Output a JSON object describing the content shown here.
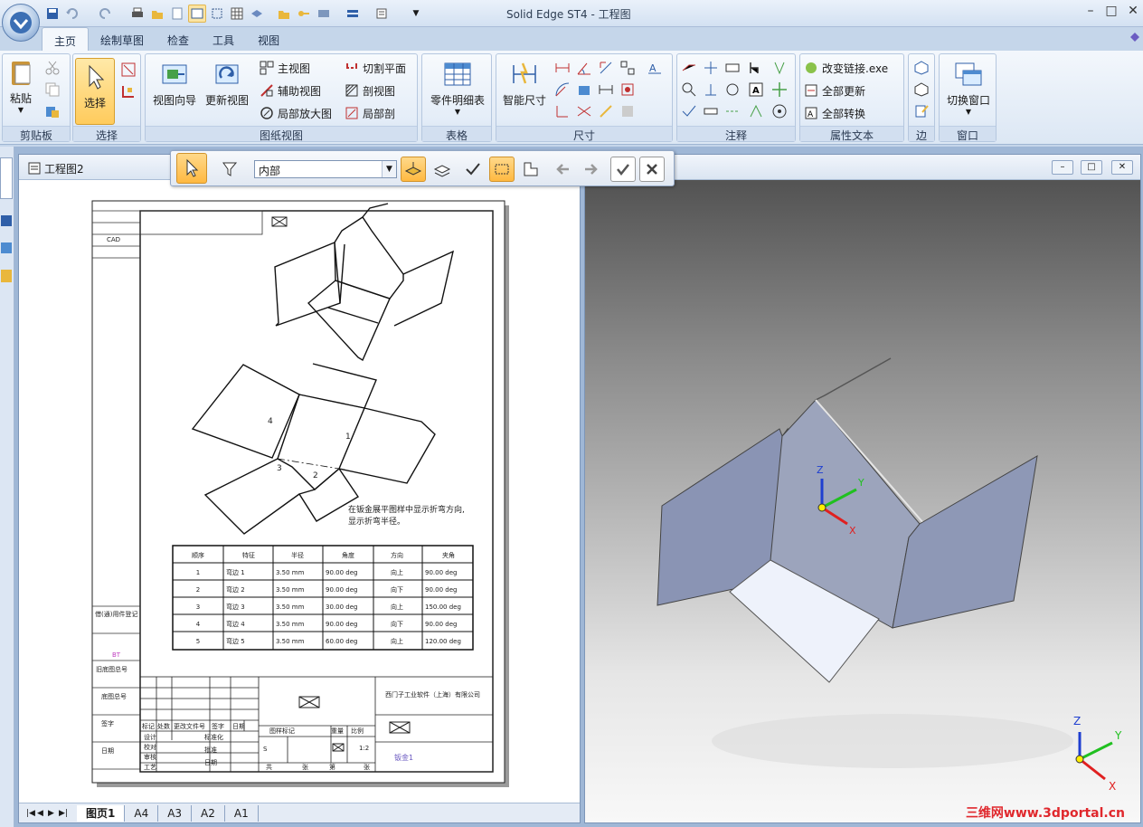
{
  "window": {
    "title": "Solid Edge ST4 - 工程图"
  },
  "title_controls": {
    "minimize": "–",
    "restore": "□",
    "close": "✕"
  },
  "tabs": [
    "主页",
    "绘制草图",
    "检查",
    "工具",
    "视图"
  ],
  "ribbon": {
    "clipboard": {
      "label": "剪贴板",
      "paste": "粘贴"
    },
    "select": {
      "label": "选择",
      "select": "选择"
    },
    "drawing_views": {
      "label": "图纸视图",
      "view_wizard": "视图向导",
      "update_views": "更新视图",
      "principal_view": "主视图",
      "auxiliary_view": "辅助视图",
      "detail_view": "局部放大图",
      "cutting_plane": "切割平面",
      "section_view": "剖视图",
      "broken_out_section": "局部剖"
    },
    "tables": {
      "label": "表格",
      "parts_list": "零件明细表"
    },
    "dimensions": {
      "label": "尺寸",
      "smart_dimension": "智能尺寸"
    },
    "annotation": {
      "label": "注释"
    },
    "property_text": {
      "label": "属性文本",
      "change_link": "改变链接.exe",
      "update_all": "全部更新",
      "convert_all": "全部转换"
    },
    "edges": {
      "label": "边"
    },
    "window": {
      "label": "窗口",
      "switch_windows": "切换窗口"
    }
  },
  "command_bar": {
    "select_option": "内部"
  },
  "drawing_window": {
    "title": "工程图2",
    "sheet_tabs": [
      "图页1",
      "A4",
      "A3",
      "A2",
      "A1"
    ],
    "active_sheet": "图页1"
  },
  "drawing": {
    "note_line1": "在钣金展平图样中显示折弯方向,",
    "note_line2": "显示折弯半径。",
    "bend_labels": [
      "1",
      "2",
      "3",
      "4"
    ],
    "table": {
      "headers": [
        "顺序",
        "特征",
        "半径",
        "角度",
        "方向",
        "夹角"
      ],
      "rows": [
        [
          "1",
          "弯边 1",
          "3.50 mm",
          "90.00 deg",
          "向上",
          "90.00 deg"
        ],
        [
          "2",
          "弯边 2",
          "3.50 mm",
          "90.00 deg",
          "向下",
          "90.00 deg"
        ],
        [
          "3",
          "弯边 3",
          "3.50 mm",
          "30.00 deg",
          "向上",
          "150.00 deg"
        ],
        [
          "4",
          "弯边 4",
          "3.50 mm",
          "90.00 deg",
          "向下",
          "90.00 deg"
        ],
        [
          "5",
          "弯边 5",
          "3.50 mm",
          "60.00 deg",
          "向上",
          "120.00 deg"
        ]
      ]
    },
    "title_block": {
      "company": "西门子工业软件（上海）有限公司",
      "part_name": "钣金1",
      "scale": "1:2",
      "left_labels": [
        "CAD",
        "借(通)用件登记",
        "旧底图总号",
        "底图总号",
        "签字",
        "日期"
      ],
      "left_value": "BT",
      "sign_rows": [
        "设计",
        "校对",
        "审核",
        "工艺"
      ],
      "header_cells": [
        "标记",
        "处数",
        "更改文件号",
        "签字",
        "日期"
      ],
      "mid_labels": [
        "标准化",
        "批准",
        "日期"
      ],
      "stage_labels": [
        "图样标记",
        "重量",
        "比例"
      ],
      "sheet_labels": [
        "共",
        "张",
        "第",
        "张"
      ],
      "stage_value": "S"
    }
  },
  "view3d": {
    "triad_labels": [
      "X",
      "Y",
      "Z"
    ],
    "watermark": "三维网www.3dportal.cn"
  },
  "colors": {
    "accent": "#ffcb5c",
    "ribbon": "#dce7f4",
    "triad_x": "#e02020",
    "triad_y": "#20c020",
    "triad_z": "#1f3fd0"
  }
}
